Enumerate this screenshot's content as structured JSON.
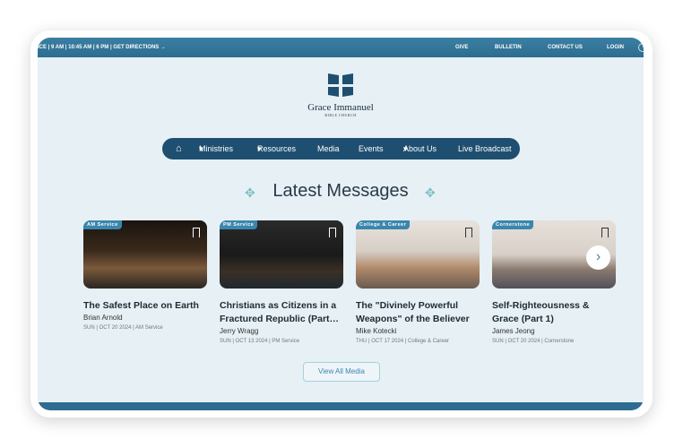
{
  "topbar": {
    "service_times": "ICE | 9 AM | 10:45 AM | 6 PM | GET DIRECTIONS",
    "arrow_icon": "arrow-right",
    "links": [
      "GIVE",
      "BULLETIN",
      "CONTACT US",
      "LOGIN"
    ]
  },
  "logo": {
    "name": "Grace Immanuel",
    "sub": "BIBLE CHURCH"
  },
  "nav": {
    "items": [
      "Ministries",
      "Resources",
      "Media",
      "Events",
      "About Us",
      "Live Broadcast"
    ]
  },
  "section": {
    "title": "Latest Messages",
    "view_all": "View All Media"
  },
  "messages": [
    {
      "tag": "AM Service",
      "title": "The Safest Place on Earth",
      "author": "Brian Arnold",
      "meta": "SUN | OCT 20 2024 | AM Service"
    },
    {
      "tag": "PM Service",
      "title": "Christians as Citizens in a Fractured Republic (Part…",
      "author": "Jerry Wragg",
      "meta": "SUN | OCT 13 2024 | PM Service"
    },
    {
      "tag": "College & Career",
      "title": "The \"Divinely Powerful Weapons\" of the Believer",
      "author": "Mike Kotecki",
      "meta": "THU | OCT 17 2024 | College & Career"
    },
    {
      "tag": "Cornerstone",
      "title": "Self-Righteousness & Grace (Part 1)",
      "author": "James Jeong",
      "meta": "SUN | OCT 20 2024 | Cornerstone"
    }
  ],
  "colors": {
    "primary": "#2d6d8f",
    "nav": "#1f4f70",
    "accent": "#3b86ad"
  }
}
